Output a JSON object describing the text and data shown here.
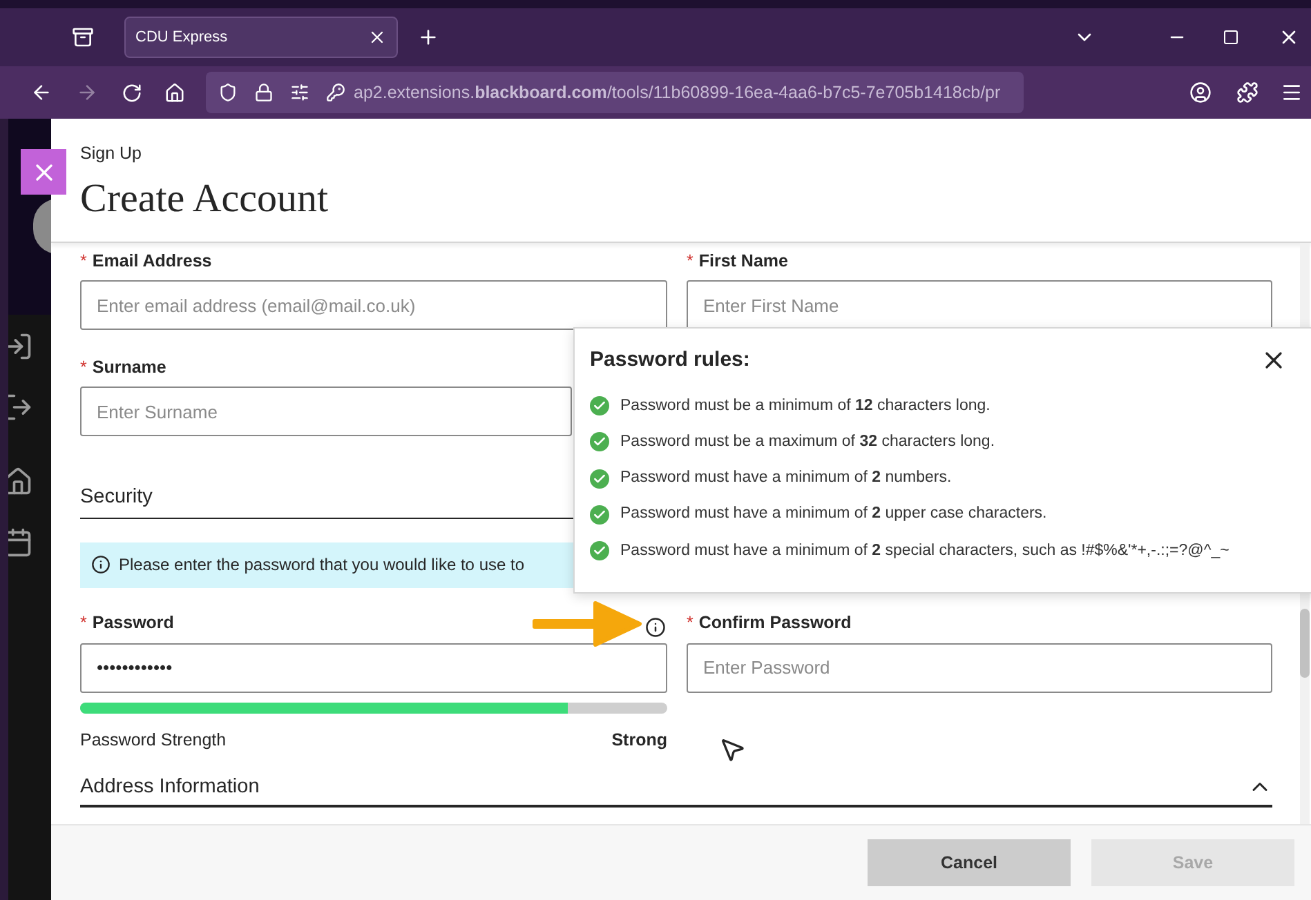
{
  "browser": {
    "tab_title": "CDU Express",
    "url": "ap2.extensions.**blackboard.com**/tools/11b60899-16ea-4aa6-b7c5-7e705b1418cb/pr"
  },
  "dialog": {
    "eyebrow": "Sign Up",
    "title": "Create Account"
  },
  "fields": [
    {
      "label": "Email Address",
      "required_mark": "*",
      "placeholder": "Enter email address (email@mail.co.uk)"
    },
    {
      "label": "First Name",
      "required_mark": "*",
      "placeholder": "Enter First Name"
    },
    {
      "label": "Surname",
      "required_mark": "*",
      "placeholder": "Enter Surname"
    }
  ],
  "security": {
    "heading": "Security",
    "info": "Please enter the password that you would like to use to"
  },
  "password": {
    "label": "Password",
    "required_mark": "*",
    "value": "••••••••••••",
    "strength_label": "Password Strength",
    "strength": "Strong",
    "level": 0.83
  },
  "confirm_password": {
    "label": "Confirm Password",
    "required_mark": "*",
    "placeholder": "Enter Password"
  },
  "address_section": {
    "heading": "Address Information",
    "expanded": true
  },
  "password_rules": {
    "title": "Password rules:",
    "rules": [
      {
        "text": "Password must be a minimum of **12** characters long.",
        "met": true
      },
      {
        "text": "Password must be a maximum of **32** characters long.",
        "met": true
      },
      {
        "text": "Password must have a minimum of **2** numbers.",
        "met": true
      },
      {
        "text": "Password must have a minimum of **2** upper case characters.",
        "met": true
      },
      {
        "text": "Password must have a minimum of **2** special characters, such as !#$%&'*+,-.:;=?@^_~",
        "met": true
      }
    ]
  },
  "buttons": [
    {
      "label": "Cancel",
      "disabled": false
    },
    {
      "label": "Save",
      "disabled": true
    }
  ]
}
